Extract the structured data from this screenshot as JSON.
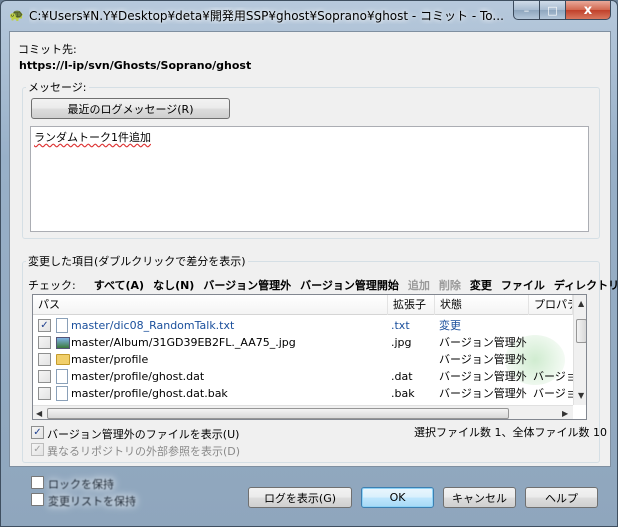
{
  "window": {
    "title": "C:¥Users¥N.Y¥Desktop¥deta¥開発用SSP¥ghost¥Soprano¥ghost - コミット - To...",
    "caption_min": "–",
    "caption_max": "□",
    "caption_close": "x"
  },
  "commit_target": {
    "label": "コミット先:",
    "url": "https://l-ip/svn/Ghosts/Soprano/ghost"
  },
  "message": {
    "group_label": "メッセージ:",
    "recent_button": "最近のログメッセージ(R)",
    "text": "ランダムトーク1件追加"
  },
  "changes": {
    "group_label": "変更した項目(ダブルクリックで差分を表示)",
    "check_label": "チェック:",
    "filters": [
      {
        "label": "すべて(A)",
        "enabled": true
      },
      {
        "label": "なし(N)",
        "enabled": true
      },
      {
        "label": "バージョン管理外",
        "enabled": true
      },
      {
        "label": "バージョン管理開始",
        "enabled": true
      },
      {
        "label": "追加",
        "enabled": false
      },
      {
        "label": "削除",
        "enabled": false
      },
      {
        "label": "変更",
        "enabled": true
      },
      {
        "label": "ファイル",
        "enabled": true
      },
      {
        "label": "ディレクトリ",
        "enabled": true
      }
    ],
    "columns": [
      "パス",
      "拡張子",
      "状態",
      "プロパティ"
    ],
    "rows": [
      {
        "checked": true,
        "icon": "text-file-icon",
        "path": "master/dic08_RandomTalk.txt",
        "ext": ".txt",
        "status": "変更",
        "props": ""
      },
      {
        "checked": false,
        "icon": "image-file-icon",
        "path": "master/Album/31GD39EB2FL._AA75_.jpg",
        "ext": ".jpg",
        "status": "バージョン管理外",
        "props": ""
      },
      {
        "checked": false,
        "icon": "folder-icon",
        "path": "master/profile",
        "ext": "",
        "status": "バージョン管理外",
        "props": ""
      },
      {
        "checked": false,
        "icon": "blank-file-icon",
        "path": "master/profile/ghost.dat",
        "ext": ".dat",
        "status": "バージョン管理外",
        "props": "バージョ"
      },
      {
        "checked": false,
        "icon": "blank-file-icon",
        "path": "master/profile/ghost.dat.bak",
        "ext": ".bak",
        "status": "バージョン管理外",
        "props": "バージョ"
      }
    ],
    "show_unversioned": {
      "label": "バージョン管理外のファイルを表示(U)",
      "checked": true
    },
    "show_externals": {
      "label": "異なるリポジトリの外部参照を表示(D)",
      "checked": true,
      "enabled": false
    },
    "summary": "選択ファイル数 1、全体ファイル数 10"
  },
  "footer": {
    "keep_locks": "ロックを保持",
    "keep_changelists": "変更リストを保持",
    "show_log": "ログを表示(G)",
    "ok": "OK",
    "cancel": "キャンセル",
    "help": "ヘルプ"
  },
  "colors": {
    "selected_text": "#1a4f9c",
    "changed_status": "#1a4f9c"
  }
}
